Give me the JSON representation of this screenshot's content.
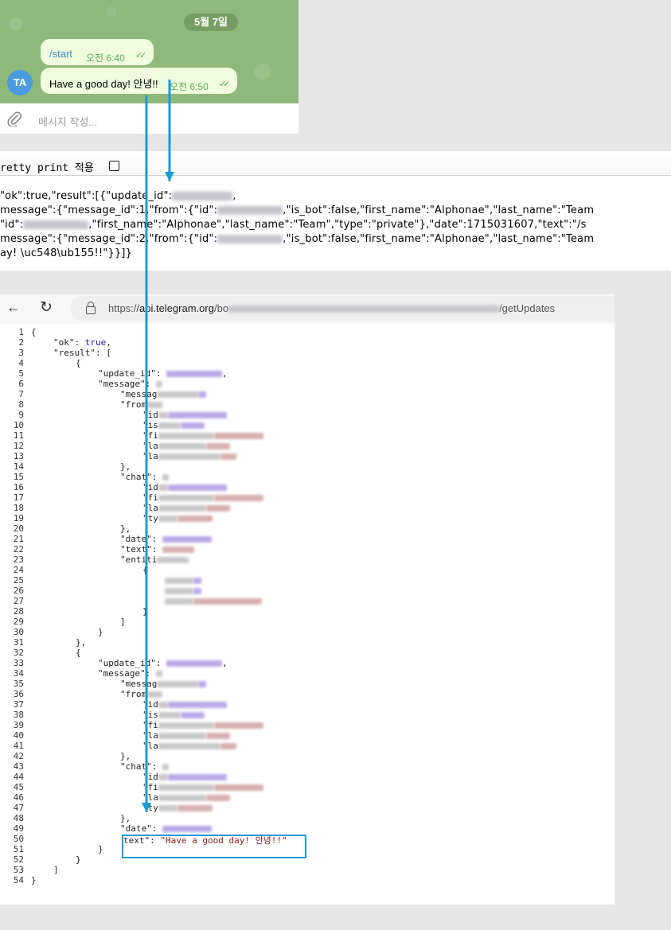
{
  "telegram": {
    "date_pill": "5월 7일",
    "messages": [
      {
        "text": "/start",
        "time": "오전 6:40"
      },
      {
        "text": "Have a good day! 안녕!!",
        "time": "오전 6:50"
      }
    ],
    "avatar_initials": "TA",
    "compose_placeholder": "메시지 작성...",
    "read_ticks": "✓✓"
  },
  "raw_response": {
    "pretty_print_label": "retty print 적용",
    "lines": {
      "l1a": "\"ok\":true,\"result\":[{\"update_id\":",
      "l1b": ",",
      "l2a": "message\":{\"message_id\":1,\"from\":{\"id\":",
      "l2b": ",\"is_bot\":false,\"first_name\":\"Alphonae\",\"last_name\":\"Team",
      "l3a": "\"id\":",
      "l3b": ",\"first_name\":\"Alphonae\",\"last_name\":\"Team\",\"type\":\"private\"},\"date\":1715031607,\"text\":\"/s",
      "l4a": "message\":{\"message_id\":2,\"from\":{\"id\":",
      "l4b": ",\"is_bot\":false,\"first_name\":\"Alphonae\",\"last_name\":\"Team",
      "l5": "ay! \\uc548\\ub155!!\"}}]}"
    }
  },
  "browser": {
    "url_prefix": "https://",
    "url_host": "api.telegram.org",
    "url_path_start": "/bo",
    "url_path_end": "/getUpdates"
  },
  "code_view": {
    "line_numbers": [
      "1",
      "2",
      "3",
      "4",
      "5",
      "6",
      "7",
      "8",
      "9",
      "10",
      "11",
      "12",
      "13",
      "14",
      "15",
      "16",
      "17",
      "18",
      "19",
      "20",
      "21",
      "22",
      "23",
      "24",
      "25",
      "26",
      "27",
      "28",
      "29",
      "30",
      "31",
      "32",
      "33",
      "34",
      "35",
      "36",
      "37",
      "38",
      "39",
      "40",
      "41",
      "42",
      "43",
      "44",
      "45",
      "46",
      "47",
      "48",
      "49",
      "50",
      "51",
      "52",
      "53",
      "54"
    ],
    "open_brace": "{",
    "close_brace": "}",
    "ok_key": "\"ok\"",
    "ok_val": "true",
    "result_key": "\"result\"",
    "update_id_key": "\"update_id\"",
    "message_key": "\"message\"",
    "message_id_key": "\"messag",
    "from_key": "\"from",
    "chat_key": "\"chat",
    "date_key": "\"date\"",
    "text_key": "\"text\"",
    "entities_key": "\"entiti",
    "text_key_short": "text\"",
    "final_text_value": "\"Have a good day! 안녕!!\""
  },
  "accent_color": "#1b9ad8"
}
